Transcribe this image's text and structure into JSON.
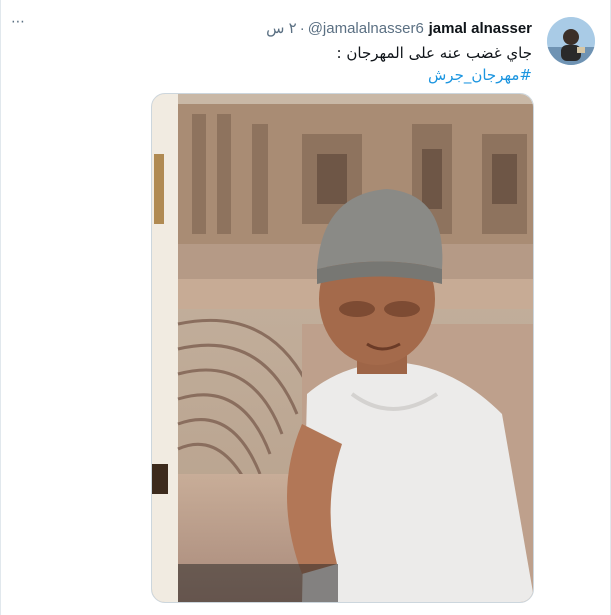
{
  "tweet": {
    "author_name": "jamal alnasser",
    "author_handle": "@jamalalnasser6",
    "separator": "·",
    "timestamp": "٢ س",
    "text": "جاي غضب عنه على المهرجان :",
    "hashtag": "#مهرجان_جرش",
    "menu_label": "⋯"
  },
  "icons": {
    "more": "more-options-icon",
    "avatar": "avatar"
  },
  "colors": {
    "name": "#0f1419",
    "meta": "#5b7083",
    "hashtag": "#1b95e0",
    "border": "#ccd6dd"
  }
}
